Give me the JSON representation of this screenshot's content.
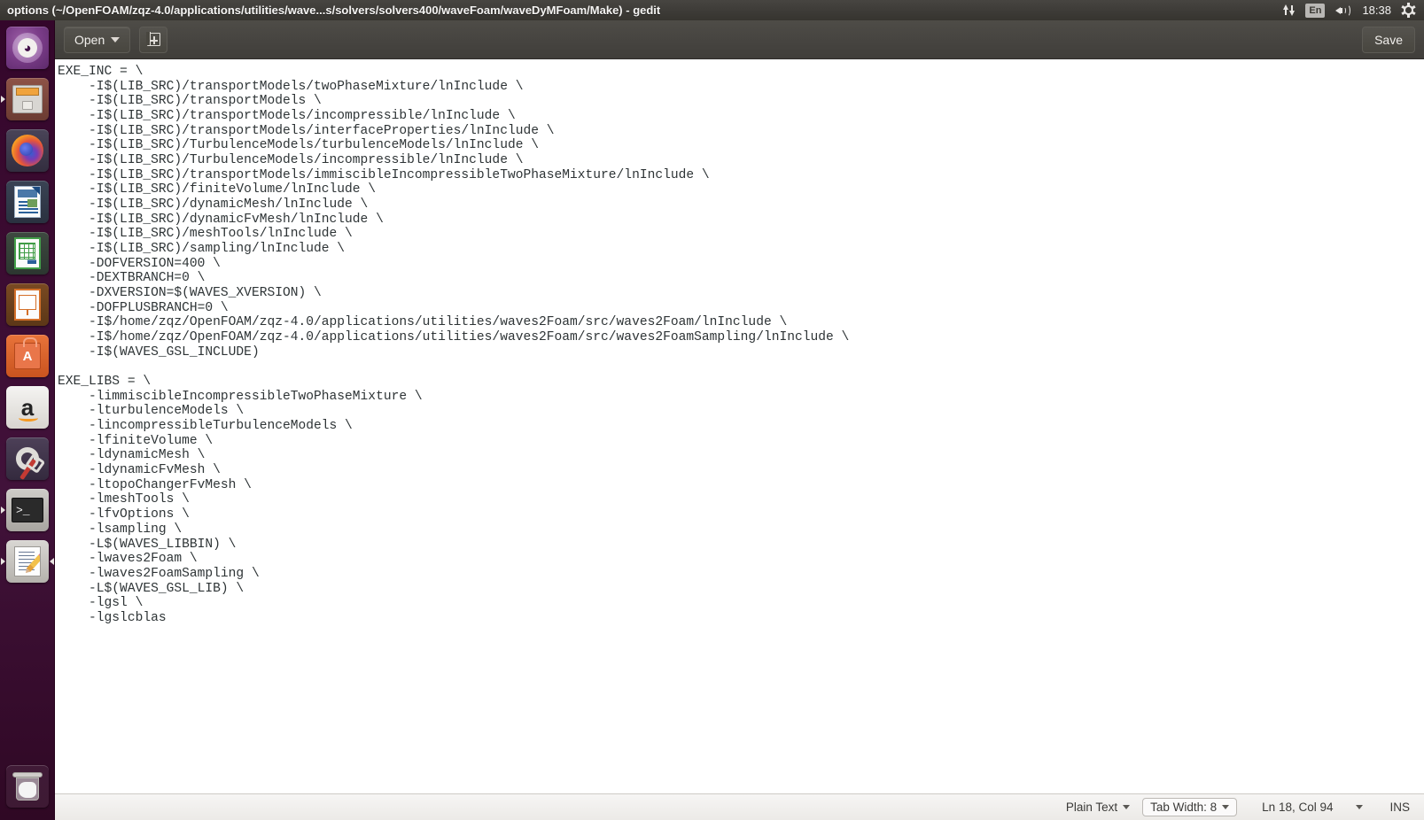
{
  "panel": {
    "title": "options (~/OpenFOAM/zqz-4.0/applications/utilities/wave...s/solvers/solvers400/waveFoam/waveDyMFoam/Make) - gedit",
    "tray": {
      "network_icon": "network-up-down-icon",
      "keyboard_layout": "En",
      "volume_icon": "volume-icon",
      "clock": "18:38",
      "settings_icon": "gear-icon"
    }
  },
  "launcher": {
    "items": [
      {
        "name": "ubuntu-dash",
        "label": "Ubuntu Dash"
      },
      {
        "name": "files",
        "label": "Files"
      },
      {
        "name": "firefox",
        "label": "Firefox"
      },
      {
        "name": "libreoffice-writer",
        "label": "LibreOffice Writer"
      },
      {
        "name": "libreoffice-calc",
        "label": "LibreOffice Calc"
      },
      {
        "name": "libreoffice-impress",
        "label": "LibreOffice Impress"
      },
      {
        "name": "ubuntu-software",
        "label": "Ubuntu Software",
        "glyph": "A"
      },
      {
        "name": "amazon",
        "label": "Amazon",
        "glyph": "a"
      },
      {
        "name": "system-settings",
        "label": "System Settings"
      },
      {
        "name": "terminal",
        "label": "Terminal",
        "prompt": ">_"
      },
      {
        "name": "gedit",
        "label": "gedit Text Editor"
      }
    ],
    "trash": {
      "name": "trash",
      "label": "Trash"
    }
  },
  "toolbar": {
    "open_label": "Open",
    "new_doc_icon": "new-document-icon",
    "save_label": "Save"
  },
  "editor": {
    "lines": [
      "EXE_INC = \\",
      "    -I$(LIB_SRC)/transportModels/twoPhaseMixture/lnInclude \\",
      "    -I$(LIB_SRC)/transportModels \\",
      "    -I$(LIB_SRC)/transportModels/incompressible/lnInclude \\",
      "    -I$(LIB_SRC)/transportModels/interfaceProperties/lnInclude \\",
      "    -I$(LIB_SRC)/TurbulenceModels/turbulenceModels/lnInclude \\",
      "    -I$(LIB_SRC)/TurbulenceModels/incompressible/lnInclude \\",
      "    -I$(LIB_SRC)/transportModels/immiscibleIncompressibleTwoPhaseMixture/lnInclude \\",
      "    -I$(LIB_SRC)/finiteVolume/lnInclude \\",
      "    -I$(LIB_SRC)/dynamicMesh/lnInclude \\",
      "    -I$(LIB_SRC)/dynamicFvMesh/lnInclude \\",
      "    -I$(LIB_SRC)/meshTools/lnInclude \\",
      "    -I$(LIB_SRC)/sampling/lnInclude \\",
      "    -DOFVERSION=400 \\",
      "    -DEXTBRANCH=0 \\",
      "    -DXVERSION=$(WAVES_XVERSION) \\",
      "    -DOFPLUSBRANCH=0 \\",
      "    -I$/home/zqz/OpenFOAM/zqz-4.0/applications/utilities/waves2Foam/src/waves2Foam/lnInclude \\",
      "    -I$/home/zqz/OpenFOAM/zqz-4.0/applications/utilities/waves2Foam/src/waves2FoamSampling/lnInclude \\",
      "    -I$(WAVES_GSL_INCLUDE)",
      "",
      "EXE_LIBS = \\",
      "    -limmiscibleIncompressibleTwoPhaseMixture \\",
      "    -lturbulenceModels \\",
      "    -lincompressibleTurbulenceModels \\",
      "    -lfiniteVolume \\",
      "    -ldynamicMesh \\",
      "    -ldynamicFvMesh \\",
      "    -ltopoChangerFvMesh \\",
      "    -lmeshTools \\",
      "    -lfvOptions \\",
      "    -lsampling \\",
      "    -L$(WAVES_LIBBIN) \\",
      "    -lwaves2Foam \\",
      "    -lwaves2FoamSampling \\",
      "    -L$(WAVES_GSL_LIB) \\",
      "    -lgsl \\",
      "    -lgslcblas"
    ]
  },
  "statusbar": {
    "language": "Plain Text",
    "tab_width": "Tab Width: 8",
    "cursor_position": "Ln 18, Col 94",
    "insert_mode": "INS"
  },
  "colors": {
    "panel_bg": "#3e3c38",
    "toolbar_bg": "#46443f",
    "editor_bg": "#ffffff",
    "editor_fg": "#2e3436",
    "launcher_bg": "#3b0b31",
    "statusbar_bg": "#eceae7"
  }
}
